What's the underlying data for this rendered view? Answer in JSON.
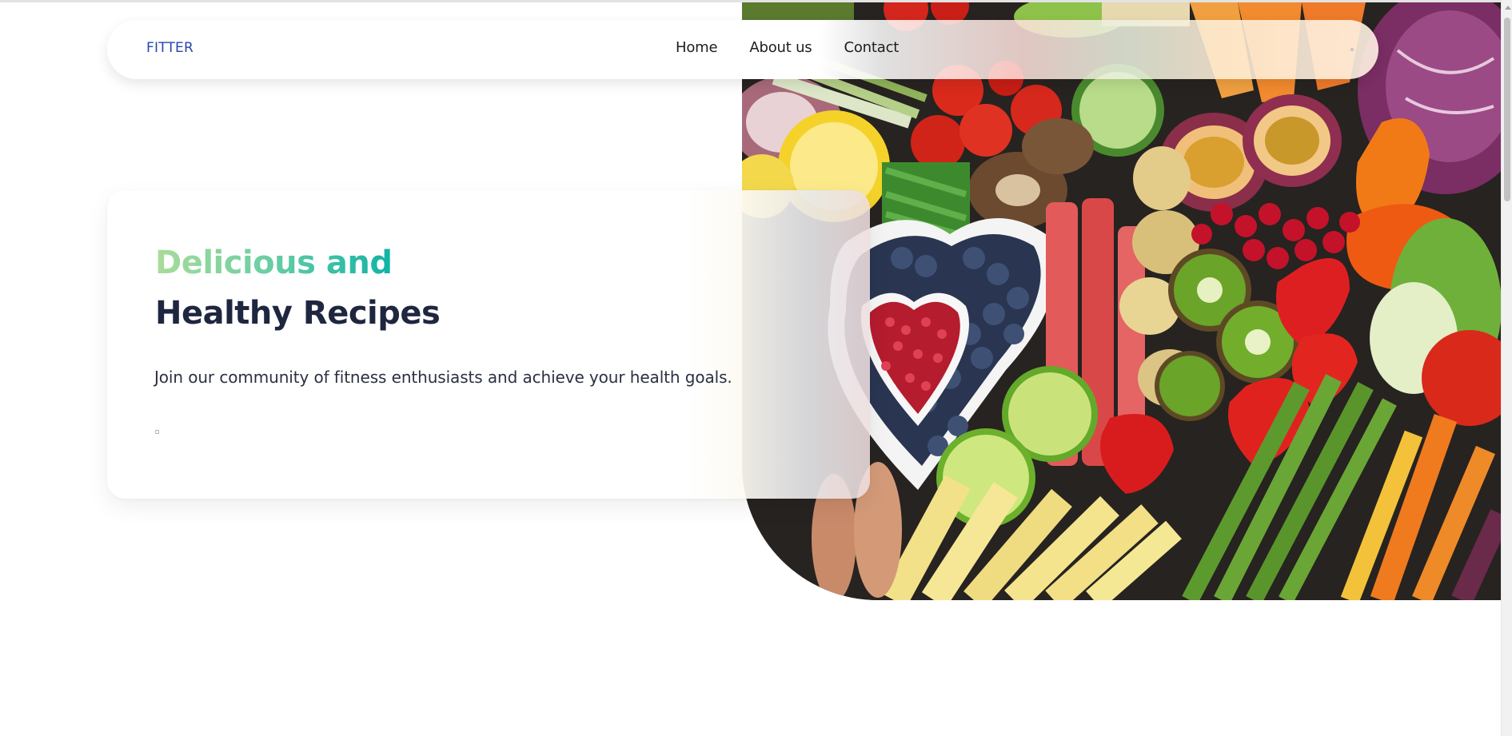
{
  "navbar": {
    "brand": "FITTER",
    "links": [
      {
        "label": "Home"
      },
      {
        "label": "About us"
      },
      {
        "label": "Contact"
      }
    ]
  },
  "hero": {
    "headline_line1": "Delicious and",
    "headline_line2": "Healthy Recipes",
    "subtext": "Join our community of fitness enthusiasts and achieve your health goals."
  },
  "icons": {
    "menu": "menu-dot-icon",
    "scroll_up": "scroll-up-arrow-icon"
  },
  "colors": {
    "brand": "#2946b0",
    "headline_gradient_start": "#a9dc98",
    "headline_gradient_end": "#0fb3a6",
    "headline_dark": "#1f2640",
    "text": "#2b3142"
  }
}
